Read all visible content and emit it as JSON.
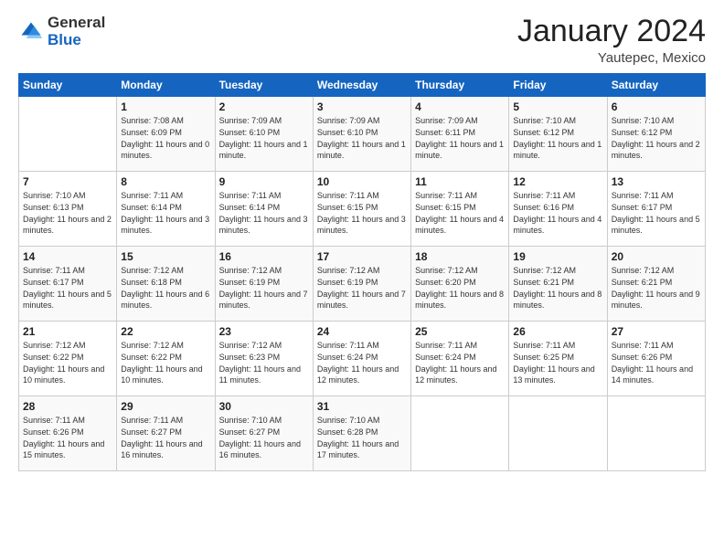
{
  "header": {
    "logo_general": "General",
    "logo_blue": "Blue",
    "month": "January 2024",
    "location": "Yautepec, Mexico"
  },
  "weekdays": [
    "Sunday",
    "Monday",
    "Tuesday",
    "Wednesday",
    "Thursday",
    "Friday",
    "Saturday"
  ],
  "weeks": [
    [
      {
        "day": "",
        "sunrise": "",
        "sunset": "",
        "daylight": ""
      },
      {
        "day": "1",
        "sunrise": "Sunrise: 7:08 AM",
        "sunset": "Sunset: 6:09 PM",
        "daylight": "Daylight: 11 hours and 0 minutes."
      },
      {
        "day": "2",
        "sunrise": "Sunrise: 7:09 AM",
        "sunset": "Sunset: 6:10 PM",
        "daylight": "Daylight: 11 hours and 1 minute."
      },
      {
        "day": "3",
        "sunrise": "Sunrise: 7:09 AM",
        "sunset": "Sunset: 6:10 PM",
        "daylight": "Daylight: 11 hours and 1 minute."
      },
      {
        "day": "4",
        "sunrise": "Sunrise: 7:09 AM",
        "sunset": "Sunset: 6:11 PM",
        "daylight": "Daylight: 11 hours and 1 minute."
      },
      {
        "day": "5",
        "sunrise": "Sunrise: 7:10 AM",
        "sunset": "Sunset: 6:12 PM",
        "daylight": "Daylight: 11 hours and 1 minute."
      },
      {
        "day": "6",
        "sunrise": "Sunrise: 7:10 AM",
        "sunset": "Sunset: 6:12 PM",
        "daylight": "Daylight: 11 hours and 2 minutes."
      }
    ],
    [
      {
        "day": "7",
        "sunrise": "Sunrise: 7:10 AM",
        "sunset": "Sunset: 6:13 PM",
        "daylight": "Daylight: 11 hours and 2 minutes."
      },
      {
        "day": "8",
        "sunrise": "Sunrise: 7:11 AM",
        "sunset": "Sunset: 6:14 PM",
        "daylight": "Daylight: 11 hours and 3 minutes."
      },
      {
        "day": "9",
        "sunrise": "Sunrise: 7:11 AM",
        "sunset": "Sunset: 6:14 PM",
        "daylight": "Daylight: 11 hours and 3 minutes."
      },
      {
        "day": "10",
        "sunrise": "Sunrise: 7:11 AM",
        "sunset": "Sunset: 6:15 PM",
        "daylight": "Daylight: 11 hours and 3 minutes."
      },
      {
        "day": "11",
        "sunrise": "Sunrise: 7:11 AM",
        "sunset": "Sunset: 6:15 PM",
        "daylight": "Daylight: 11 hours and 4 minutes."
      },
      {
        "day": "12",
        "sunrise": "Sunrise: 7:11 AM",
        "sunset": "Sunset: 6:16 PM",
        "daylight": "Daylight: 11 hours and 4 minutes."
      },
      {
        "day": "13",
        "sunrise": "Sunrise: 7:11 AM",
        "sunset": "Sunset: 6:17 PM",
        "daylight": "Daylight: 11 hours and 5 minutes."
      }
    ],
    [
      {
        "day": "14",
        "sunrise": "Sunrise: 7:11 AM",
        "sunset": "Sunset: 6:17 PM",
        "daylight": "Daylight: 11 hours and 5 minutes."
      },
      {
        "day": "15",
        "sunrise": "Sunrise: 7:12 AM",
        "sunset": "Sunset: 6:18 PM",
        "daylight": "Daylight: 11 hours and 6 minutes."
      },
      {
        "day": "16",
        "sunrise": "Sunrise: 7:12 AM",
        "sunset": "Sunset: 6:19 PM",
        "daylight": "Daylight: 11 hours and 7 minutes."
      },
      {
        "day": "17",
        "sunrise": "Sunrise: 7:12 AM",
        "sunset": "Sunset: 6:19 PM",
        "daylight": "Daylight: 11 hours and 7 minutes."
      },
      {
        "day": "18",
        "sunrise": "Sunrise: 7:12 AM",
        "sunset": "Sunset: 6:20 PM",
        "daylight": "Daylight: 11 hours and 8 minutes."
      },
      {
        "day": "19",
        "sunrise": "Sunrise: 7:12 AM",
        "sunset": "Sunset: 6:21 PM",
        "daylight": "Daylight: 11 hours and 8 minutes."
      },
      {
        "day": "20",
        "sunrise": "Sunrise: 7:12 AM",
        "sunset": "Sunset: 6:21 PM",
        "daylight": "Daylight: 11 hours and 9 minutes."
      }
    ],
    [
      {
        "day": "21",
        "sunrise": "Sunrise: 7:12 AM",
        "sunset": "Sunset: 6:22 PM",
        "daylight": "Daylight: 11 hours and 10 minutes."
      },
      {
        "day": "22",
        "sunrise": "Sunrise: 7:12 AM",
        "sunset": "Sunset: 6:22 PM",
        "daylight": "Daylight: 11 hours and 10 minutes."
      },
      {
        "day": "23",
        "sunrise": "Sunrise: 7:12 AM",
        "sunset": "Sunset: 6:23 PM",
        "daylight": "Daylight: 11 hours and 11 minutes."
      },
      {
        "day": "24",
        "sunrise": "Sunrise: 7:11 AM",
        "sunset": "Sunset: 6:24 PM",
        "daylight": "Daylight: 11 hours and 12 minutes."
      },
      {
        "day": "25",
        "sunrise": "Sunrise: 7:11 AM",
        "sunset": "Sunset: 6:24 PM",
        "daylight": "Daylight: 11 hours and 12 minutes."
      },
      {
        "day": "26",
        "sunrise": "Sunrise: 7:11 AM",
        "sunset": "Sunset: 6:25 PM",
        "daylight": "Daylight: 11 hours and 13 minutes."
      },
      {
        "day": "27",
        "sunrise": "Sunrise: 7:11 AM",
        "sunset": "Sunset: 6:26 PM",
        "daylight": "Daylight: 11 hours and 14 minutes."
      }
    ],
    [
      {
        "day": "28",
        "sunrise": "Sunrise: 7:11 AM",
        "sunset": "Sunset: 6:26 PM",
        "daylight": "Daylight: 11 hours and 15 minutes."
      },
      {
        "day": "29",
        "sunrise": "Sunrise: 7:11 AM",
        "sunset": "Sunset: 6:27 PM",
        "daylight": "Daylight: 11 hours and 16 minutes."
      },
      {
        "day": "30",
        "sunrise": "Sunrise: 7:10 AM",
        "sunset": "Sunset: 6:27 PM",
        "daylight": "Daylight: 11 hours and 16 minutes."
      },
      {
        "day": "31",
        "sunrise": "Sunrise: 7:10 AM",
        "sunset": "Sunset: 6:28 PM",
        "daylight": "Daylight: 11 hours and 17 minutes."
      },
      {
        "day": "",
        "sunrise": "",
        "sunset": "",
        "daylight": ""
      },
      {
        "day": "",
        "sunrise": "",
        "sunset": "",
        "daylight": ""
      },
      {
        "day": "",
        "sunrise": "",
        "sunset": "",
        "daylight": ""
      }
    ]
  ]
}
